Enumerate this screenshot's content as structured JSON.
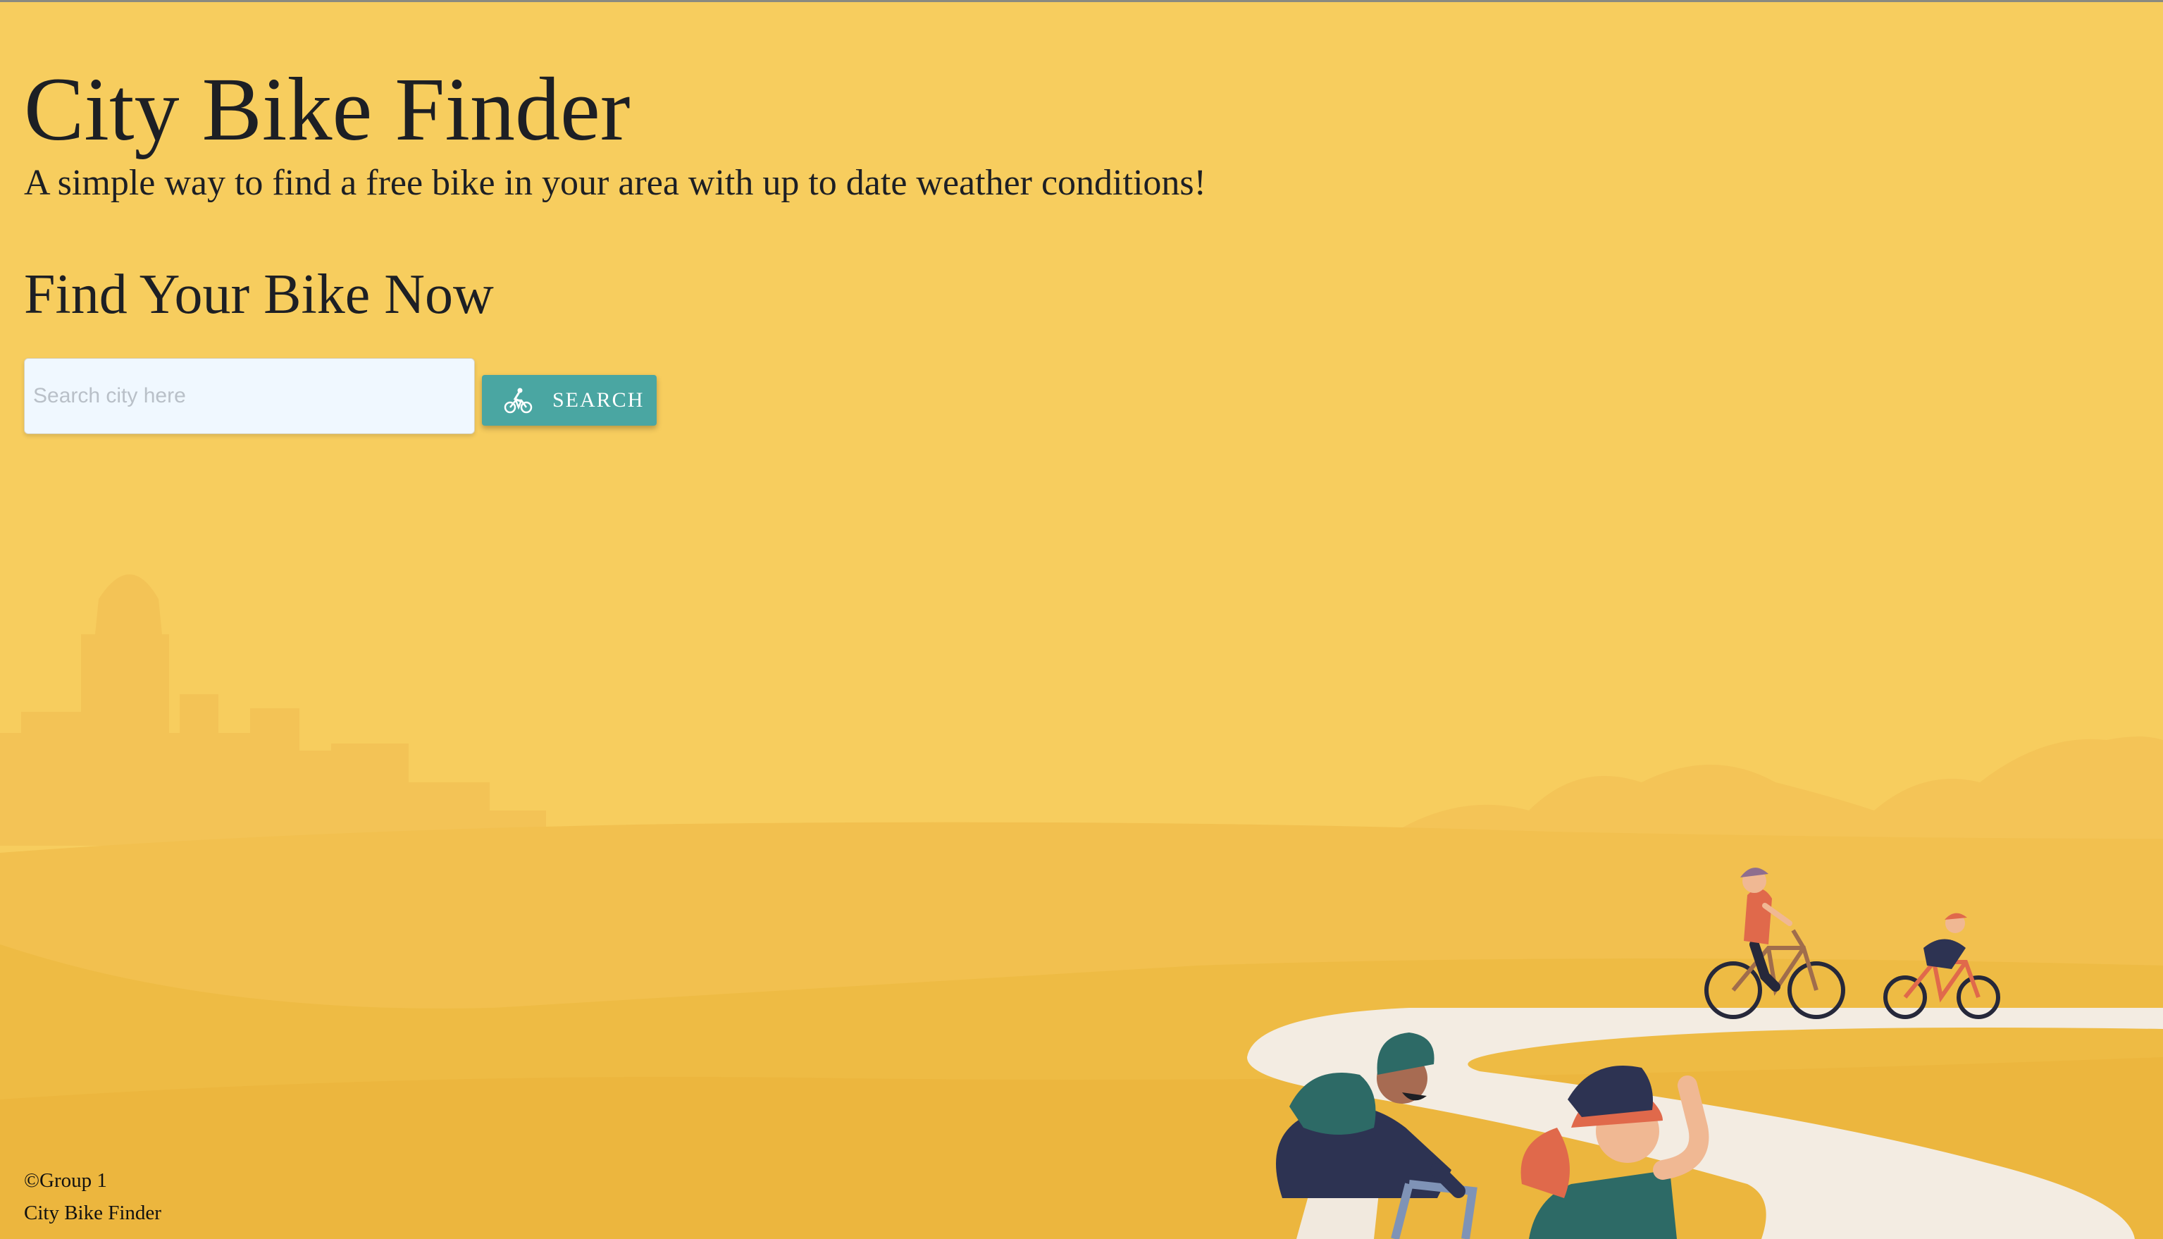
{
  "header": {
    "title": "City Bike Finder",
    "subtitle": "A simple way to find a free bike in your area with up to date weather conditions!"
  },
  "search": {
    "heading": "Find Your Bike Now",
    "placeholder": "Search city here",
    "value": "",
    "button_label": "SEARCH",
    "button_icon": "bicycle-rider-icon"
  },
  "footer": {
    "copyright": "©Group 1",
    "app_name": "City Bike Finder"
  },
  "colors": {
    "background": "#f7cd5e",
    "accent": "#4aa6a2",
    "input_background": "#f0f8ff"
  }
}
